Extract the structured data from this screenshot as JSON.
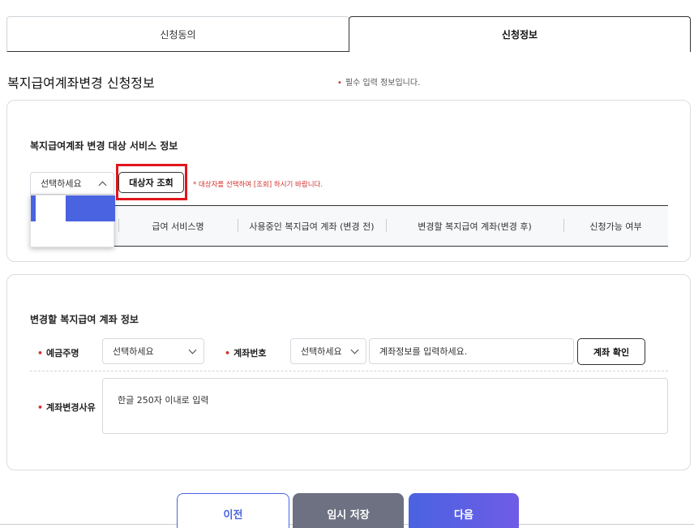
{
  "tabs": [
    {
      "label": "신청동의",
      "active": false
    },
    {
      "label": "신청정보",
      "active": true
    }
  ],
  "page_title": "복지급여계좌변경 신청정보",
  "required_note": "필수 입력 정보입니다.",
  "required_marker": "•",
  "target_section": {
    "title": "복지급여계좌 변경 대상 서비스 정보",
    "select": {
      "value": "선택하세요",
      "expanded": true
    },
    "search_button": "대상자 조회",
    "hint": "* 대상자를 선택하여 [조회] 하시기 바랍니다.",
    "table_columns": [
      "급여 서비스명",
      "사용중인 복지급여 계좌 (변경 전)",
      "변경할 복지급여 계좌(변경 후)",
      "신청가능 여부"
    ]
  },
  "account_section": {
    "title": "변경할 복지급여 계좌 정보",
    "holder_label": "예금주명",
    "holder_select": "선택하세요",
    "account_label": "계좌번호",
    "bank_select": "선택하세요",
    "account_placeholder": "계좌정보를 입력하세요.",
    "verify_button": "계좌 확인",
    "reason_label": "계좌변경사유",
    "reason_placeholder": "한글 250자 이내로 입력"
  },
  "footer": {
    "prev": "이전",
    "save": "임시 저장",
    "next": "다음"
  },
  "colors": {
    "accent": "#4a63e0",
    "required": "#d0312d",
    "highlight": "#e0161b",
    "save_button": "#6d7181"
  }
}
